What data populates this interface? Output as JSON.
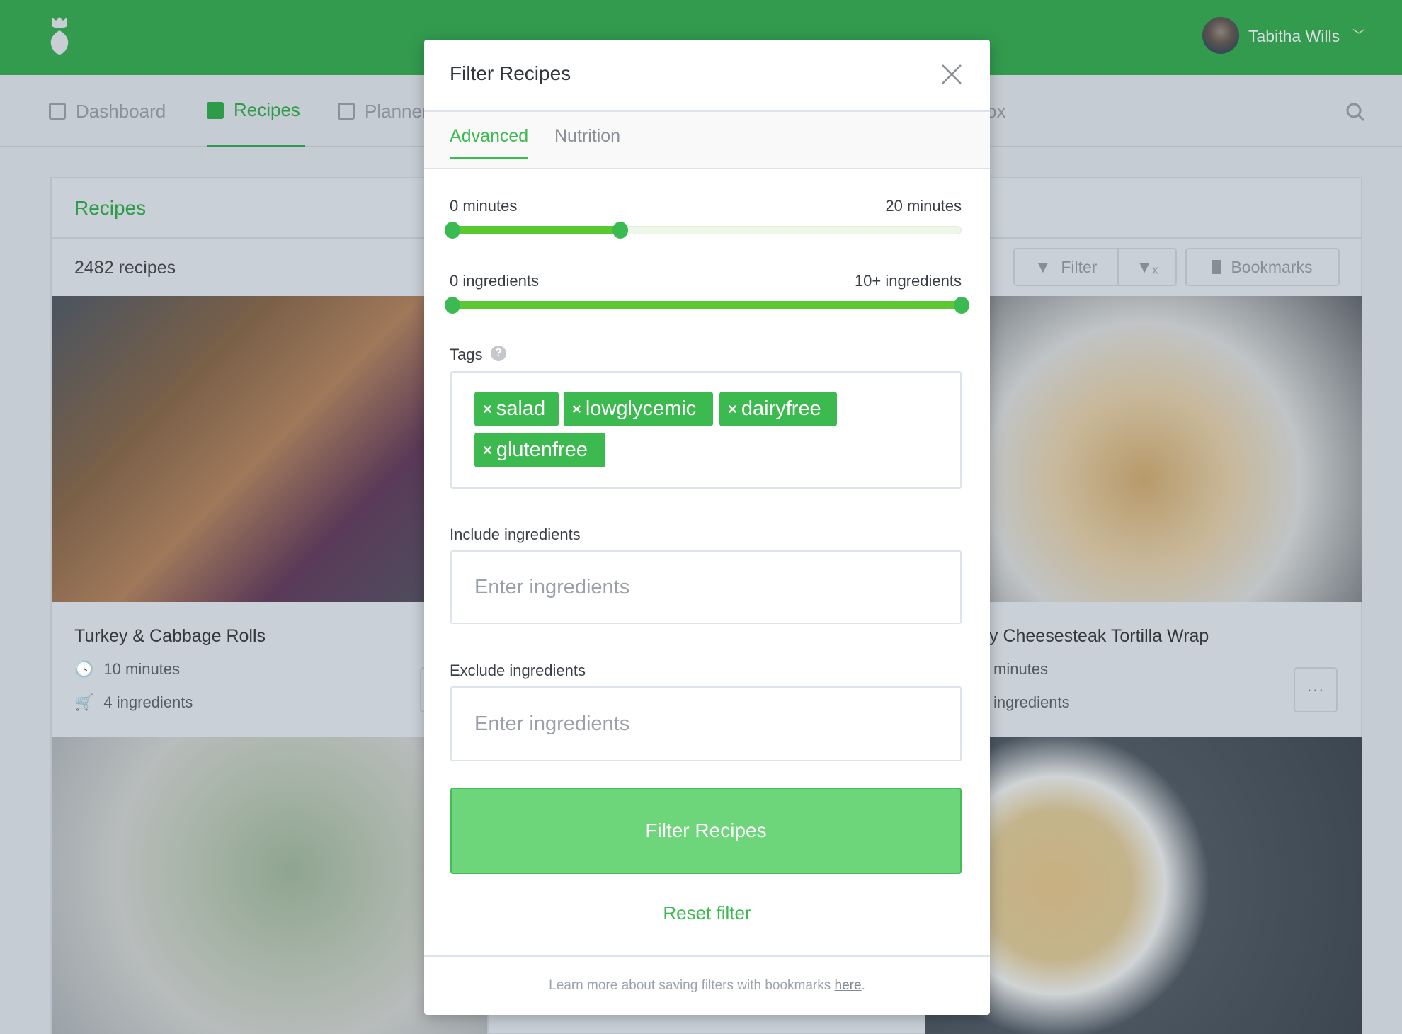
{
  "header": {
    "user_name": "Tabitha Wills",
    "brand_color": "#329b4e"
  },
  "nav": {
    "items": [
      {
        "label": "Dashboard"
      },
      {
        "label": "Recipes",
        "active": true
      },
      {
        "label": "Planner"
      },
      {
        "label": "ox"
      }
    ]
  },
  "panel": {
    "title": "Recipes",
    "count": "2482 recipes",
    "filter_label": "Filter",
    "bookmarks_label": "Bookmarks"
  },
  "cards": [
    {
      "title": "Turkey & Cabbage Rolls",
      "time": "10 minutes",
      "ingredients": "4 ingredients"
    },
    {
      "title": "y Cheesesteak Tortilla Wrap",
      "time": "minutes",
      "ingredients": "ingredients",
      "more": "···"
    }
  ],
  "modal": {
    "title": "Filter Recipes",
    "tabs": [
      {
        "label": "Advanced",
        "active": true
      },
      {
        "label": "Nutrition"
      }
    ],
    "time_slider": {
      "min_label": "0 minutes",
      "max_label": "20 minutes",
      "low": 0,
      "high": 0.33
    },
    "ingredient_slider": {
      "min_label": "0 ingredients",
      "max_label": "10+ ingredients",
      "low": 0,
      "high": 1
    },
    "tags_label": "Tags",
    "tags": [
      "salad",
      "lowglycemic",
      "dairyfree",
      "glutenfree"
    ],
    "include_label": "Include ingredients",
    "include_placeholder": "Enter ingredients",
    "exclude_label": "Exclude ingredients",
    "exclude_placeholder": "Enter ingredients",
    "submit_label": "Filter Recipes",
    "reset_label": "Reset filter",
    "footer_text": "Learn more about saving filters with bookmarks ",
    "footer_link": "here",
    "footer_end": "."
  }
}
